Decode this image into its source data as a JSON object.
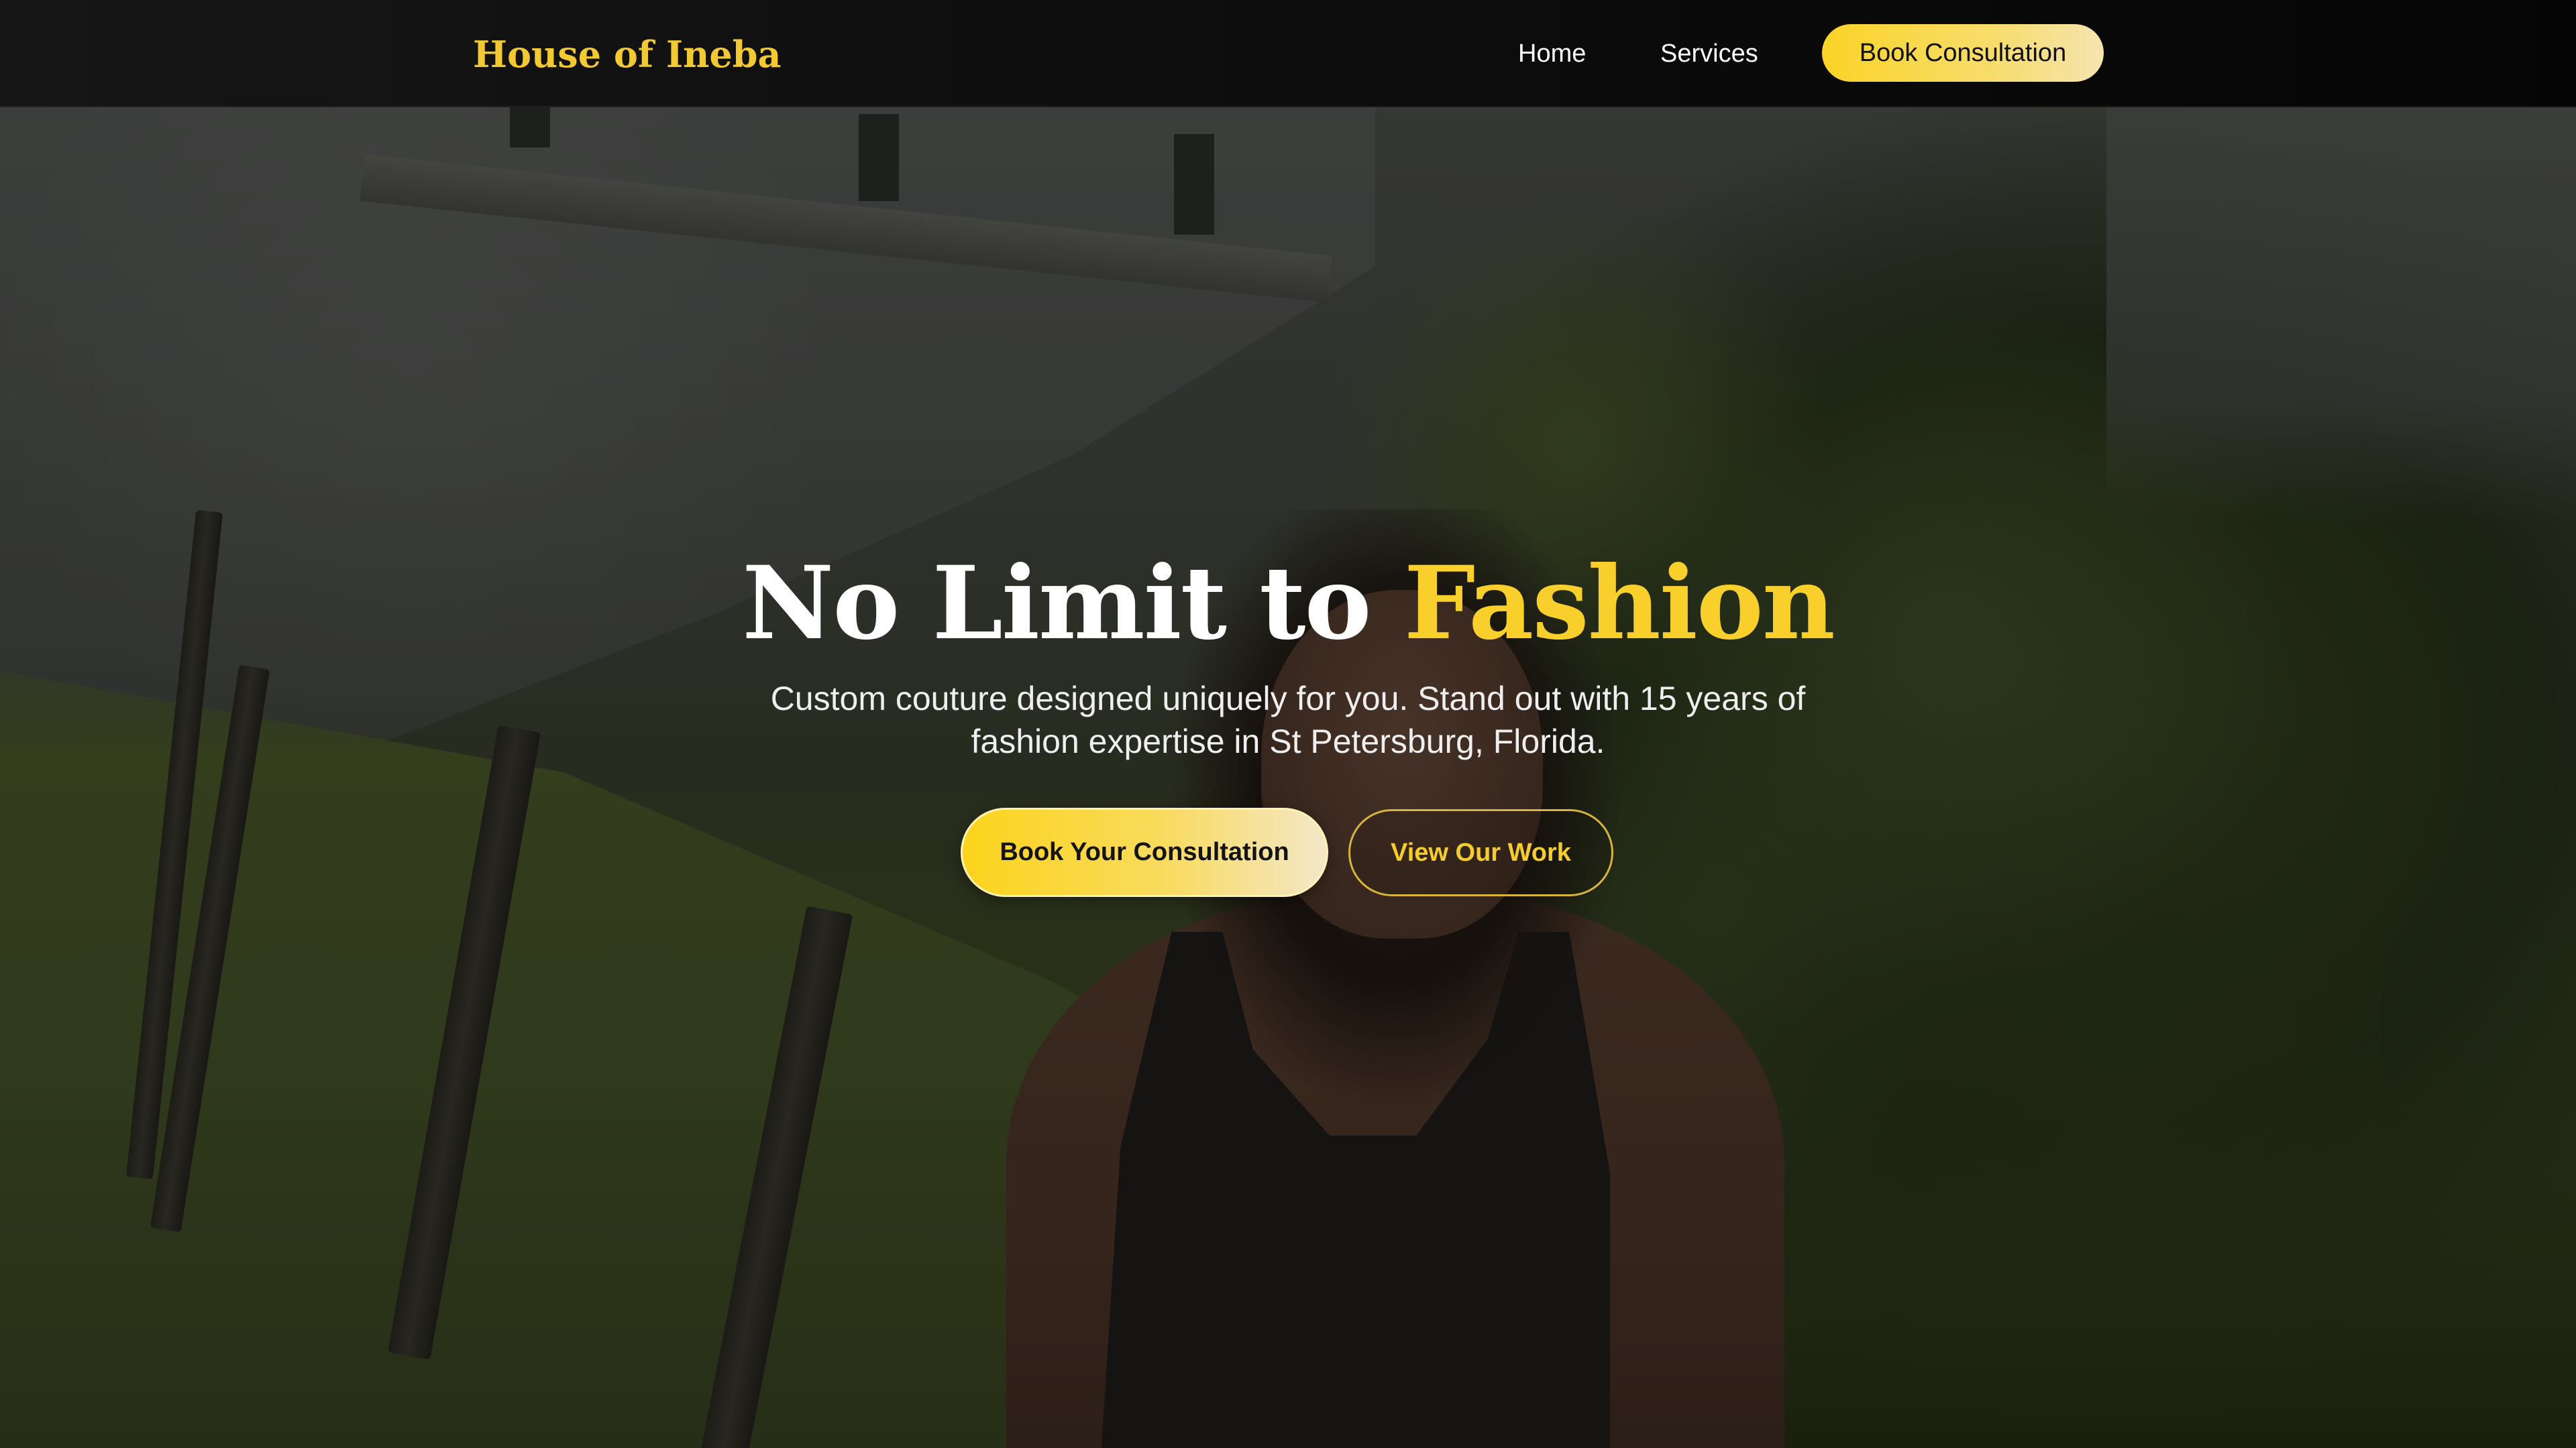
{
  "navbar": {
    "brand": "House of Ineba",
    "links": [
      {
        "label": "Home"
      },
      {
        "label": "Services"
      }
    ],
    "cta_label": "Book Consultation"
  },
  "hero": {
    "title_main": "No Limit to ",
    "title_accent": "Fashion",
    "subtitle": "Custom couture designed uniquely for you. Stand out with 15 years of fashion expertise in St Petersburg, Florida.",
    "primary_button": "Book Your Consultation",
    "secondary_button": "View Our Work"
  },
  "colors": {
    "accent": "#f9cf2b",
    "navbar_bg": "#0d0d0d",
    "text_light": "#ffffff"
  }
}
